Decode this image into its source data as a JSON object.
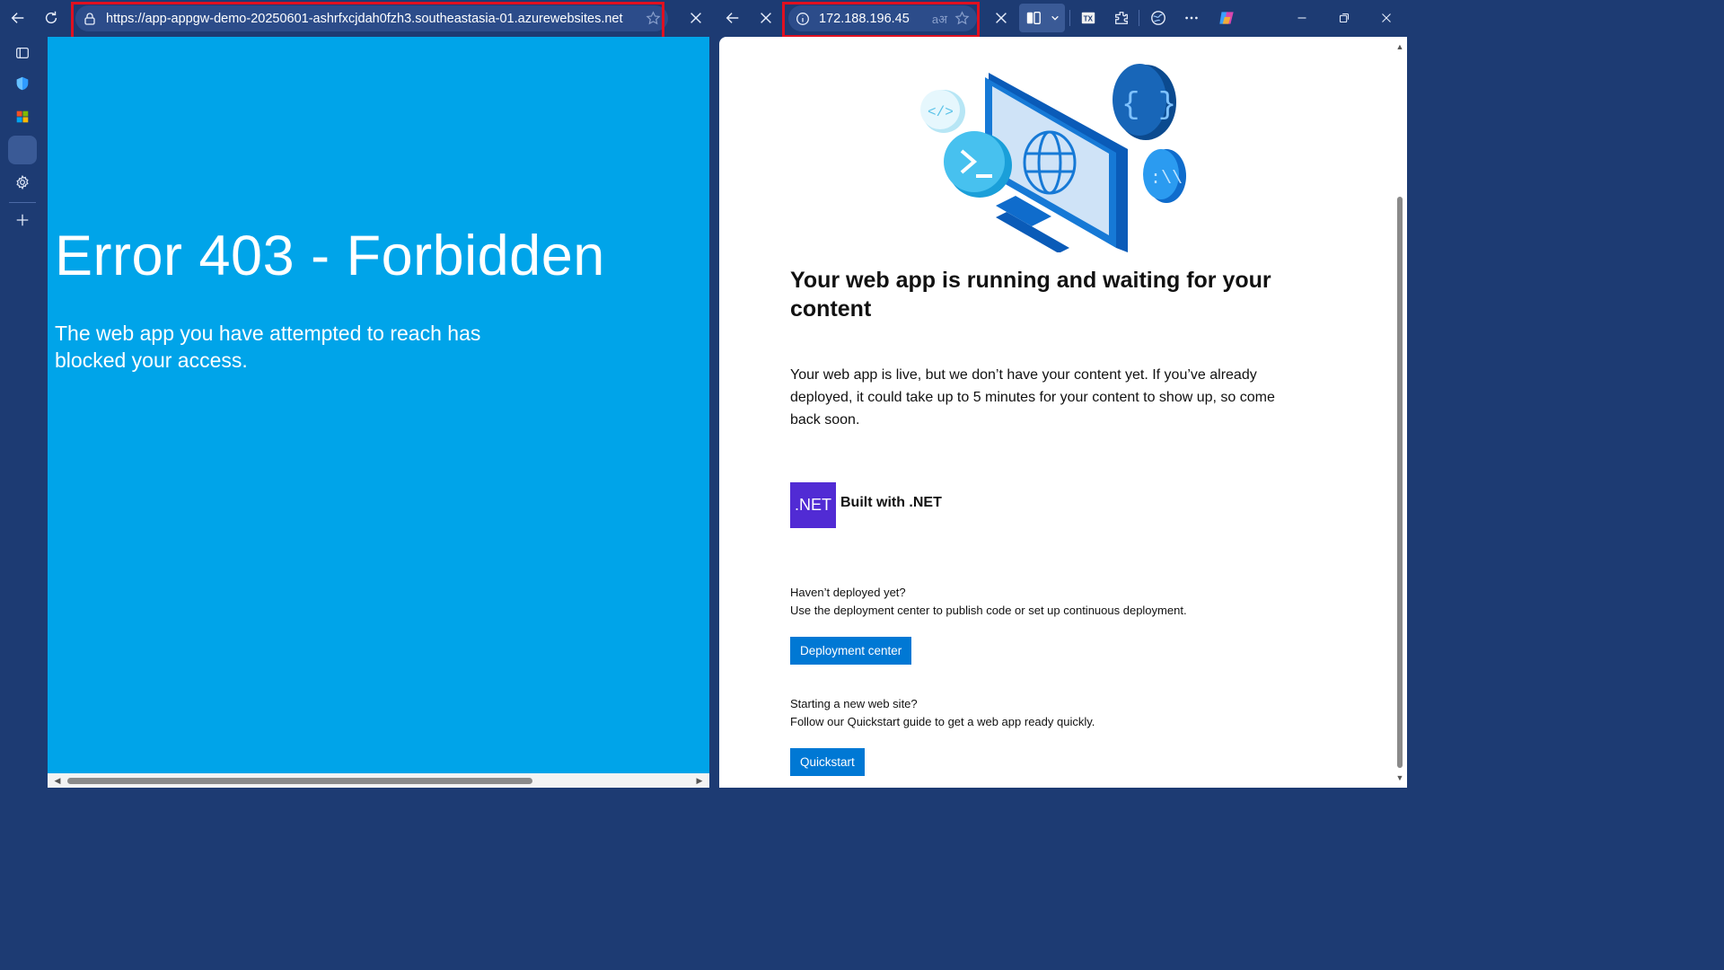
{
  "left_tab": {
    "url": "https://app-appgw-demo-20250601-ashrfxcjdah0fzh3.southeastasia-01.azurewebsites.net"
  },
  "right_tab": {
    "url": "172.188.196.45",
    "translate_glyph": "aअ"
  },
  "left_page": {
    "title": "Error 403 - Forbidden",
    "message": "The web app you have attempted to reach has blocked your access."
  },
  "right_page": {
    "title": "Your web app is running and waiting for your content",
    "body": "Your web app is live, but we don’t have your content yet. If you’ve already deployed, it could take up to 5 minutes for your content to show up, so come back soon.",
    "badge": ".NET",
    "badge_label": "Built with .NET",
    "deploy_heading": "Haven’t deployed yet?",
    "deploy_text": "Use the deployment center to publish code or set up continuous deployment.",
    "deploy_button": "Deployment center",
    "quickstart_heading": "Starting a new web site?",
    "quickstart_text": "Follow our Quickstart guide to get a web app ready quickly.",
    "quickstart_button": "Quickstart"
  },
  "icons": {
    "toolbar": [
      "back-icon",
      "refresh-icon",
      "lock-icon",
      "star-icon",
      "close-icon",
      "info-icon",
      "read-aloud-icon",
      "split-screen-icon",
      "chevron-down-icon",
      "translate-extension-icon",
      "extensions-icon",
      "browser-essentials-icon",
      "more-icon",
      "copilot-icon",
      "minimize-icon",
      "restore-icon"
    ],
    "sidebar": [
      "tab-actions-icon",
      "shield-icon",
      "apps-icon",
      "settings-icon",
      "add-icon"
    ]
  },
  "colors": {
    "browser_frame": "#1d3b73",
    "error_background": "#00a4e9",
    "button_blue": "#0078d4",
    "dotnet_purple": "#512bd4",
    "highlight_red": "#e01020"
  }
}
